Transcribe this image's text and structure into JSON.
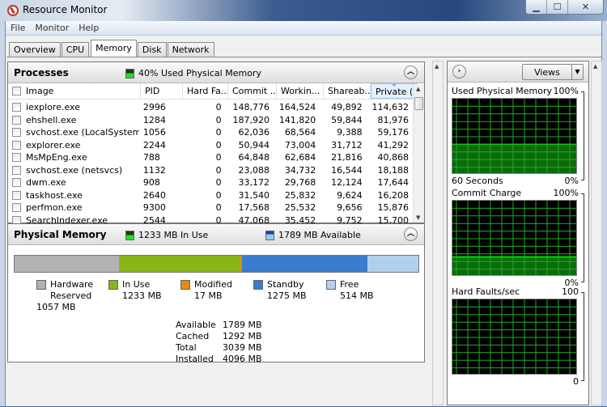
{
  "window": {
    "title": "Resource Monitor",
    "controls": [
      "minimize",
      "maximize",
      "close"
    ]
  },
  "menu": [
    "File",
    "Monitor",
    "Help"
  ],
  "tabs": [
    {
      "label": "Overview",
      "active": false
    },
    {
      "label": "CPU",
      "active": false
    },
    {
      "label": "Memory",
      "active": true
    },
    {
      "label": "Disk",
      "active": false
    },
    {
      "label": "Network",
      "active": false
    }
  ],
  "processes": {
    "title": "Processes",
    "summary": "40% Used Physical Memory",
    "columns": [
      "Image",
      "PID",
      "Hard Fa...",
      "Commit ...",
      "Workin...",
      "Shareab...",
      "Private (..."
    ],
    "sorted_column": "Private (...",
    "rows": [
      {
        "image": "iexplore.exe",
        "pid": "2996",
        "hard_faults": "0",
        "commit": "148,776",
        "working": "164,524",
        "shareable": "49,892",
        "private": "114,632"
      },
      {
        "image": "ehshell.exe",
        "pid": "1284",
        "hard_faults": "0",
        "commit": "187,920",
        "working": "141,820",
        "shareable": "59,844",
        "private": "81,976"
      },
      {
        "image": "svchost.exe (LocalSystemNet...",
        "pid": "1056",
        "hard_faults": "0",
        "commit": "62,036",
        "working": "68,564",
        "shareable": "9,388",
        "private": "59,176"
      },
      {
        "image": "explorer.exe",
        "pid": "2244",
        "hard_faults": "0",
        "commit": "50,944",
        "working": "73,004",
        "shareable": "31,712",
        "private": "41,292"
      },
      {
        "image": "MsMpEng.exe",
        "pid": "788",
        "hard_faults": "0",
        "commit": "64,848",
        "working": "62,684",
        "shareable": "21,816",
        "private": "40,868"
      },
      {
        "image": "svchost.exe (netsvcs)",
        "pid": "1132",
        "hard_faults": "0",
        "commit": "23,088",
        "working": "34,732",
        "shareable": "16,544",
        "private": "18,188"
      },
      {
        "image": "dwm.exe",
        "pid": "908",
        "hard_faults": "0",
        "commit": "33,172",
        "working": "29,768",
        "shareable": "12,124",
        "private": "17,644"
      },
      {
        "image": "taskhost.exe",
        "pid": "2640",
        "hard_faults": "0",
        "commit": "31,540",
        "working": "25,832",
        "shareable": "9,624",
        "private": "16,208"
      },
      {
        "image": "perfmon.exe",
        "pid": "9300",
        "hard_faults": "0",
        "commit": "17,568",
        "working": "25,532",
        "shareable": "9,656",
        "private": "15,876"
      },
      {
        "image": "SearchIndexer.exe",
        "pid": "2544",
        "hard_faults": "0",
        "commit": "47,068",
        "working": "35,452",
        "shareable": "9,752",
        "private": "15,700"
      }
    ]
  },
  "physical_memory": {
    "title": "Physical Memory",
    "in_use_summary": "1233 MB In Use",
    "available_summary": "1789 MB Available",
    "segments": [
      {
        "name": "Hardware Reserved",
        "mb": 1057,
        "color": "#b3b3b3"
      },
      {
        "name": "In Use",
        "mb": 1233,
        "color": "#8ab516"
      },
      {
        "name": "Modified",
        "mb": 17,
        "color": "#e8880c"
      },
      {
        "name": "Standby",
        "mb": 1275,
        "color": "#3b7ccc"
      },
      {
        "name": "Free",
        "mb": 514,
        "color": "#b3cfee"
      }
    ],
    "legend": {
      "hardware_line1": "Hardware",
      "hardware_line2": "Reserved",
      "hardware_value": "1057 MB",
      "in_use_label": "In Use",
      "in_use_value": "1233 MB",
      "modified_label": "Modified",
      "modified_value": "17 MB",
      "standby_label": "Standby",
      "standby_value": "1275 MB",
      "free_label": "Free",
      "free_value": "514 MB"
    },
    "stats": [
      {
        "label": "Available",
        "value": "1789 MB"
      },
      {
        "label": "Cached",
        "value": "1292 MB"
      },
      {
        "label": "Total",
        "value": "3039 MB"
      },
      {
        "label": "Installed",
        "value": "4096 MB"
      }
    ]
  },
  "graphs_panel": {
    "views_label": "Views",
    "graphs": [
      {
        "title": "Used Physical Memory",
        "max": "100%",
        "min": "0%",
        "bottom_label": "60 Seconds",
        "level_pct": 40,
        "color": "#00ff00"
      },
      {
        "title": "Commit Charge",
        "max": "100%",
        "min": "0%",
        "bottom_label": "",
        "level_pct": 26,
        "color": "#00ff00"
      },
      {
        "title": "Hard Faults/sec",
        "max": "100",
        "min": "0",
        "bottom_label": "",
        "level_pct": 0,
        "color": "#00ff00"
      }
    ]
  }
}
